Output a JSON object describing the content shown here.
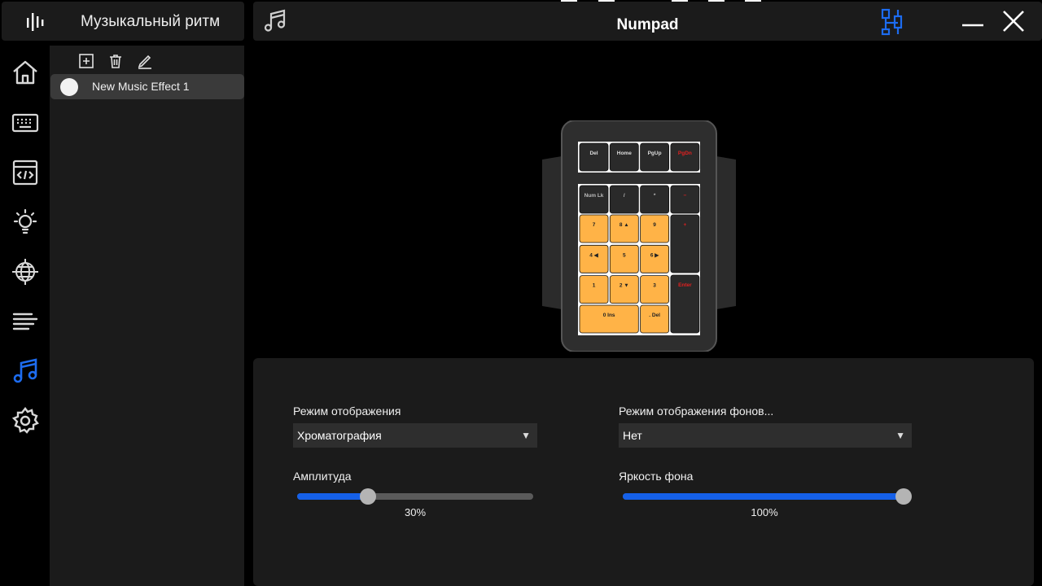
{
  "app": {
    "title": "Музыкальный ритм"
  },
  "header": {
    "device_name": "Numpad"
  },
  "nav": {
    "items": [
      {
        "name": "home-icon",
        "active": false
      },
      {
        "name": "keyboard-icon",
        "active": false
      },
      {
        "name": "macro-icon",
        "active": false
      },
      {
        "name": "lighting-icon",
        "active": false
      },
      {
        "name": "network-icon",
        "active": false
      },
      {
        "name": "equalizer-icon",
        "active": false
      },
      {
        "name": "music-note-icon",
        "active": true
      },
      {
        "name": "gear-icon",
        "active": false
      }
    ]
  },
  "effects": {
    "tools": [
      "add-icon",
      "trash-icon",
      "rename-icon"
    ],
    "items": [
      {
        "label": "New Music Effect 1",
        "selected": true
      }
    ]
  },
  "keyboard": {
    "nav_keys": [
      "Del",
      "Home",
      "PgUp",
      "PgDn"
    ],
    "top_row": [
      "Num Lk",
      "/",
      "*",
      "−"
    ],
    "grid_rows": [
      [
        "7",
        "8 ▲",
        "9"
      ],
      [
        "4 ◀",
        "5",
        "6 ▶"
      ],
      [
        "1",
        "2 ▼",
        "3"
      ]
    ],
    "plus_key": "+",
    "enter_key": "Enter",
    "zero_key": "0 Ins",
    "dot_key": ". Del"
  },
  "settings": {
    "display_mode": {
      "label": "Режим отображения",
      "value": "Хроматография"
    },
    "background_mode": {
      "label": "Режим отображения фонов...",
      "value": "Нет"
    },
    "amplitude": {
      "label": "Амплитуда",
      "value": 30,
      "value_text": "30%"
    },
    "brightness": {
      "label": "Яркость фона",
      "value": 100,
      "value_text": "100%"
    }
  },
  "colors": {
    "accent": "#1560e8",
    "panel": "#1b1b1b",
    "key_lit": "#ffb347",
    "key_dark": "#2a2a2a",
    "key_red_text": "#e02020"
  }
}
